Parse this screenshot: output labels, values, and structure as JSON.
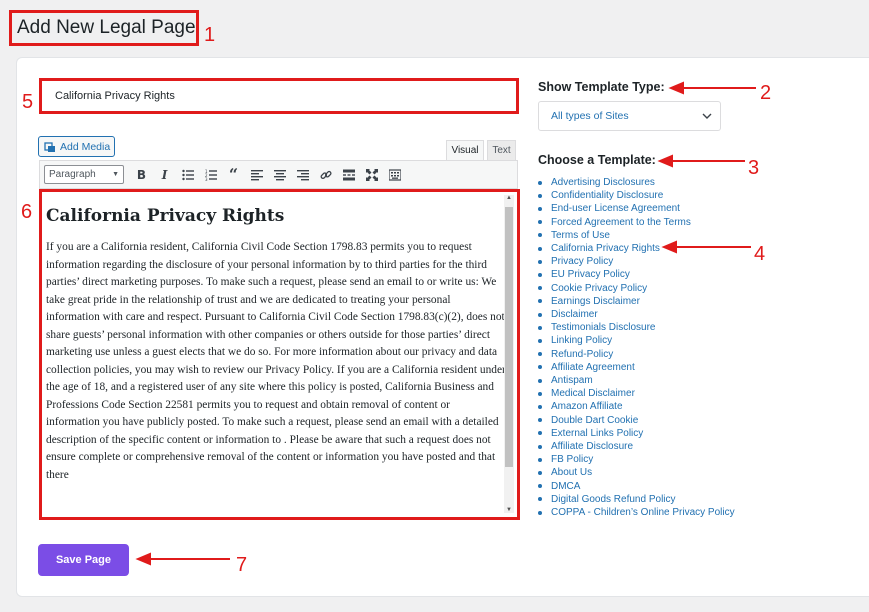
{
  "page": {
    "title": "Add New Legal Page"
  },
  "annotations": [
    "1",
    "2",
    "3",
    "4",
    "5",
    "6",
    "7"
  ],
  "title_input": {
    "value": "California Privacy Rights"
  },
  "editor": {
    "add_media_label": "Add Media",
    "tabs": [
      "Visual",
      "Text"
    ],
    "format_select": "Paragraph",
    "heading": "California Privacy Rights",
    "body": "If you are a California resident, California Civil Code Section 1798.83 permits you to request information regarding the disclosure of your personal information by to third parties for the third parties’ direct marketing purposes. To make such a request, please send an email to or write us: We take great pride in the relationship of trust and we are dedicated to treating your personal information with care and respect. Pursuant to California Civil Code Section 1798.83(c)(2), does not share guests’ personal information with other companies or others outside for those parties’ direct marketing use unless a guest elects that we do so.  For more information about our privacy and data collection policies, you may wish to review our Privacy Policy. If you are a California resident under the age of 18, and a registered user of any site where this policy is posted, California Business and Professions Code Section 22581 permits you to request and obtain removal of content or information you have publicly posted. To make such a request, please send an email with a detailed description of the specific content or information to . Please be aware that such a request does not ensure complete or comprehensive removal of the content or information you have posted and that there"
  },
  "save_button": "Save Page",
  "sidebar": {
    "template_type_label": "Show Template Type:",
    "template_type_value": "All types of Sites",
    "choose_template_label": "Choose a Template:",
    "templates": [
      "Advertising Disclosures",
      "Confidentiality Disclosure",
      "End-user License Agreement",
      "Forced Agreement to the Terms",
      "Terms of Use",
      "California Privacy Rights",
      "Privacy Policy",
      "EU Privacy Policy",
      "Cookie Privacy Policy",
      "Earnings Disclaimer",
      "Disclaimer",
      "Testimonials Disclosure",
      "Linking Policy",
      "Refund-Policy",
      "Affiliate Agreement",
      "Antispam",
      "Medical Disclaimer",
      "Amazon Affiliate",
      "Double Dart Cookie",
      "External Links Policy",
      "Affiliate Disclosure",
      "FB Policy",
      "About Us",
      "DMCA",
      "Digital Goods Refund Policy",
      "COPPA - Children’s Online Privacy Policy"
    ]
  },
  "colors": {
    "annotation_red": "#e01b1b",
    "accent_purple": "#7b4de6",
    "link_blue": "#2271b1"
  }
}
